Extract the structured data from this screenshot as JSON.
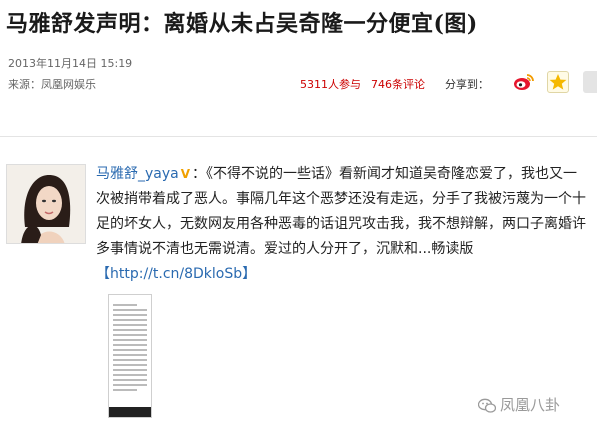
{
  "title": "马雅舒发声明：离婚从未占吴奇隆一分便宜(图)",
  "meta": {
    "date": "2013年11月14日  15:19",
    "source": "来源：凤凰网娱乐",
    "participants": "5311人参与",
    "comments": "746条评论",
    "share_label": "分享到："
  },
  "post": {
    "author": "马雅舒_yaya",
    "verified_badge": "V",
    "text": "：《不得不说的一些话》看新闻才知道吴奇隆恋爱了，我也又一次被捎带着成了恶人。事隔几年这个恶梦还没有走远，分手了我被污蔑为一个十足的坏女人，无数网友用各种恶毒的话诅咒攻击我，我不想辩解，两口子离婚许多事情说不清也无需说清。爱过的人分开了，沉默和...畅读版",
    "link": "【http://t.cn/8DkloSb】"
  },
  "watermark": "凤凰八卦",
  "colors": {
    "accent_red": "#cc0000",
    "link_blue": "#2a6ab0",
    "badge_orange": "#f0a000"
  },
  "icons": [
    "weibo-icon",
    "star-icon",
    "share-partial-icon",
    "avatar-photo",
    "image-thumbnail",
    "wechat-watermark-icon"
  ]
}
